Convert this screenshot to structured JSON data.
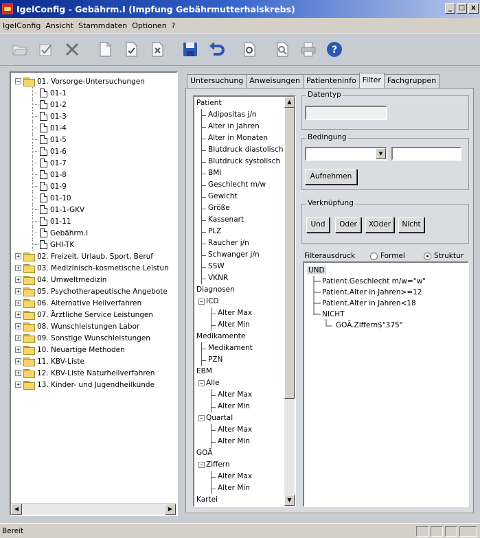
{
  "window": {
    "title": "IgelConfig - Gebährm.I (Impfung Gebährmutterhalskrebs)",
    "controls": [
      "_",
      "□",
      "x"
    ]
  },
  "menu": [
    "IgelConfig",
    "Ansicht",
    "Stammdaten",
    "Optionen",
    "?"
  ],
  "toolbar_icons": [
    "open-folder-icon",
    "check-doc-icon",
    "delete-x-icon",
    "new-doc-icon",
    "checked-doc-icon",
    "remove-doc-icon",
    "save-icon",
    "undo-icon",
    "refresh-icon",
    "preview-icon",
    "print-icon",
    "help-icon"
  ],
  "tree": {
    "root_open": "01. Vorsorge-Untersuchungen",
    "children": [
      "01-1",
      "01-2",
      "01-3",
      "01-4",
      "01-5",
      "01-6",
      "01-7",
      "01-8",
      "01-9",
      "01-10",
      "01-1-GKV",
      "01-11",
      "Gebährm.I",
      "GHI-TK"
    ],
    "folders": [
      "02. Freizeit, Urlaub, Sport, Beruf",
      "03. Medizinisch-kosmetische Leistun",
      "04. Umweltmedizin",
      "05. Psychotherapeutische Angebote",
      "06. Alternative Heilverfahren",
      "07. Ärztliche Service Leistungen",
      "08. Wunschleistungen Labor",
      "09. Sonstige Wunschleistungen",
      "10. Neuartige Methoden",
      "11. KBV-Liste",
      "12. KBV-Liste Naturheilverfahren",
      "13. Kinder- und Jugendheilkunde"
    ]
  },
  "tabs": [
    "Untersuchung",
    "Anweisungen",
    "Patienteninfo",
    "Filter",
    "Fachgruppen"
  ],
  "active_tab": "Filter",
  "fields": {
    "patient": "Patient",
    "patient_items": [
      "Adipositas j/n",
      "Alter in Jahren",
      "Alter in Monaten",
      "Blutdruck diastolisch",
      "Blutdruck systolisch",
      "BMI",
      "Geschlecht m/w",
      "Gewicht",
      "Größe",
      "Kassenart",
      "PLZ",
      "Raucher j/n",
      "Schwanger j/n",
      "SSW",
      "VKNR"
    ],
    "diagnosen": "Diagnosen",
    "icd": "ICD",
    "icd_items": [
      "Alter Max",
      "Alter Min"
    ],
    "medikamente": "Medikamente",
    "med_items": [
      "Medikament",
      "PZN"
    ],
    "ebm": "EBM",
    "alle": "Alle",
    "alle_items": [
      "Alter Max",
      "Alter Min"
    ],
    "quartal": "Quartal",
    "quartal_items": [
      "Alter Max",
      "Alter Min"
    ],
    "goa": "GOÄ",
    "ziffern": "Ziffern",
    "ziffern_items": [
      "Alter Max",
      "Alter Min"
    ],
    "kartei": "Kartei"
  },
  "datentyp": {
    "label": "Datentyp",
    "value": ""
  },
  "bedingung": {
    "label": "Bedingung",
    "select_value": "",
    "input_value": "",
    "add_button": "Aufnehmen"
  },
  "verknuepfung": {
    "label": "Verknüpfung",
    "buttons": [
      "Und",
      "Oder",
      "XOder",
      "Nicht"
    ]
  },
  "filterausdruck": {
    "label": "Filterausdruck",
    "radio_formel": "Formel",
    "radio_struktur": "Struktur",
    "selected": "Struktur",
    "root": "UND",
    "items": [
      "Patient.Geschlecht m/w=\"w\"",
      "Patient.Alter in Jahren>=12",
      "Patient.Alter in Jahren<18",
      "NICHT"
    ],
    "nested": "GOÄ.Ziffern$\"375\""
  },
  "status": "Bereit"
}
